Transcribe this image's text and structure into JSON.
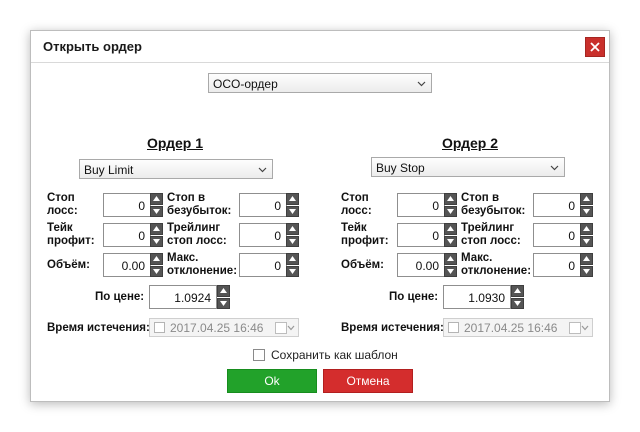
{
  "dialog": {
    "title": "Открыть ордер",
    "order_type": "OCO-ордер"
  },
  "orders": [
    {
      "title": "Ордер 1",
      "type": "Buy Limit",
      "stop_loss_label": "Стоп лосс:",
      "stop_loss": "0",
      "breakeven_label": "Стоп в безубыток:",
      "breakeven": "0",
      "take_profit_label": "Тейк профит:",
      "take_profit": "0",
      "trailing_label": "Трейлинг стоп лосс:",
      "trailing": "0",
      "volume_label": "Объём:",
      "volume": "0.00",
      "max_dev_label": "Макс. отклонение:",
      "max_dev": "0",
      "price_label": "По цене:",
      "price": "1.0924",
      "expiry_label": "Время истечения:",
      "expiry": "2017.04.25 16:46"
    },
    {
      "title": "Ордер 2",
      "type": "Buy Stop",
      "stop_loss_label": "Стоп лосс:",
      "stop_loss": "0",
      "breakeven_label": "Стоп в безубыток:",
      "breakeven": "0",
      "take_profit_label": "Тейк профит:",
      "take_profit": "0",
      "trailing_label": "Трейлинг стоп лосс:",
      "trailing": "0",
      "volume_label": "Объём:",
      "volume": "0.00",
      "max_dev_label": "Макс. отклонение:",
      "max_dev": "0",
      "price_label": "По цене:",
      "price": "1.0930",
      "expiry_label": "Время истечения:",
      "expiry": "2017.04.25 16:46"
    }
  ],
  "save_template_label": "Сохранить как шаблон",
  "buttons": {
    "ok": "Ok",
    "cancel": "Отмена"
  },
  "colors": {
    "ok": "#22a22a",
    "cancel": "#d42d2d",
    "close": "#c9302c",
    "spinner": "#555555"
  }
}
